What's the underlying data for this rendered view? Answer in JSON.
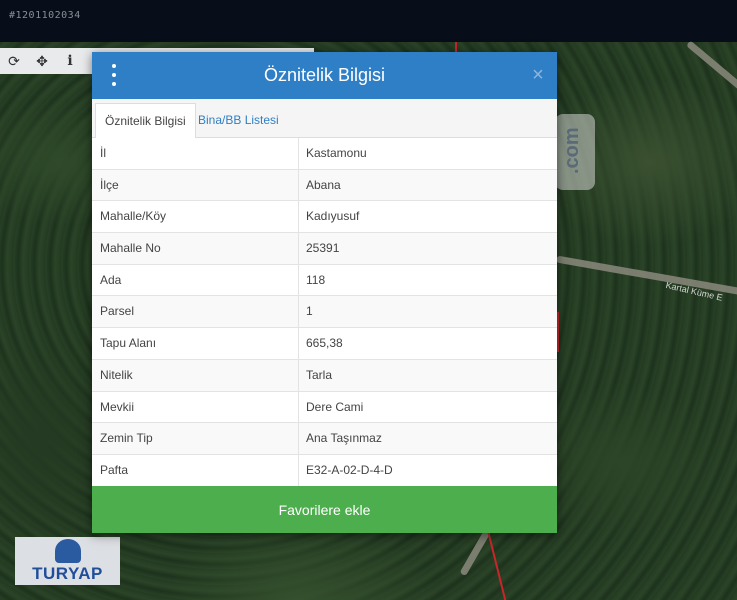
{
  "listing_id": "#1201102034",
  "map": {
    "road_label": "Kartal Küme E",
    "watermark_text": ".com",
    "toolbar": [
      {
        "icon": "refresh-icon",
        "glyph": "⟳"
      },
      {
        "icon": "move-icon",
        "glyph": "✥"
      },
      {
        "icon": "info-icon",
        "glyph": "i"
      }
    ]
  },
  "modal": {
    "title": "Öznitelik Bilgisi",
    "close_glyph": "×",
    "tabs": [
      {
        "label": "Öznitelik Bilgisi",
        "active": true
      },
      {
        "label": "Bina/BB Listesi",
        "active": false
      }
    ],
    "rows": [
      {
        "label": "İl",
        "value": "Kastamonu"
      },
      {
        "label": "İlçe",
        "value": "Abana"
      },
      {
        "label": "Mahalle/Köy",
        "value": "Kadıyusuf"
      },
      {
        "label": "Mahalle No",
        "value": "25391"
      },
      {
        "label": "Ada",
        "value": "118"
      },
      {
        "label": "Parsel",
        "value": "1"
      },
      {
        "label": "Tapu Alanı",
        "value": "665,38"
      },
      {
        "label": "Nitelik",
        "value": "Tarla"
      },
      {
        "label": "Mevkii",
        "value": "Dere Cami"
      },
      {
        "label": "Zemin Tip",
        "value": "Ana Taşınmaz"
      },
      {
        "label": "Pafta",
        "value": "E32-A-02-D-4-D"
      }
    ],
    "favorite_button": "Favorilere ekle"
  },
  "logo": {
    "text": "TURYAP"
  },
  "colors": {
    "header": "#2f7fc6",
    "button": "#4cae4c",
    "topbar": "#080d1a"
  }
}
